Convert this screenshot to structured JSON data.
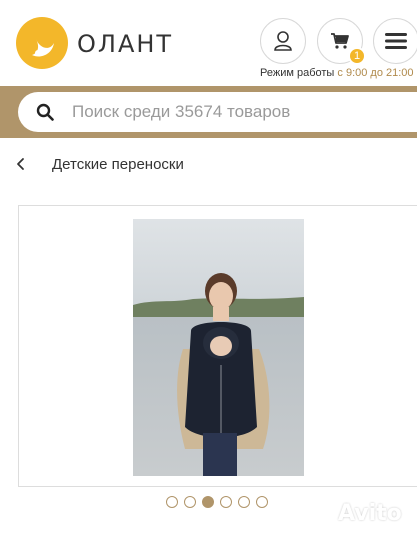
{
  "header": {
    "logo_text": "ОЛАНТ",
    "cart_count": "1",
    "hours_prefix": "Режим работы",
    "hours_value": "с 9:00 до 21:00"
  },
  "search": {
    "placeholder": "Поиск среди 35674 товаров",
    "icon": "search-icon"
  },
  "breadcrumb": {
    "back_icon": "chevron-left-icon",
    "title": "Детские переноски"
  },
  "gallery": {
    "total_images": 6,
    "active_index": 2
  },
  "watermark": {
    "text": "Avito"
  },
  "colors": {
    "brand_gold": "#b0956a",
    "logo_yellow": "#f3b72a",
    "badge": "#f3b72a"
  }
}
